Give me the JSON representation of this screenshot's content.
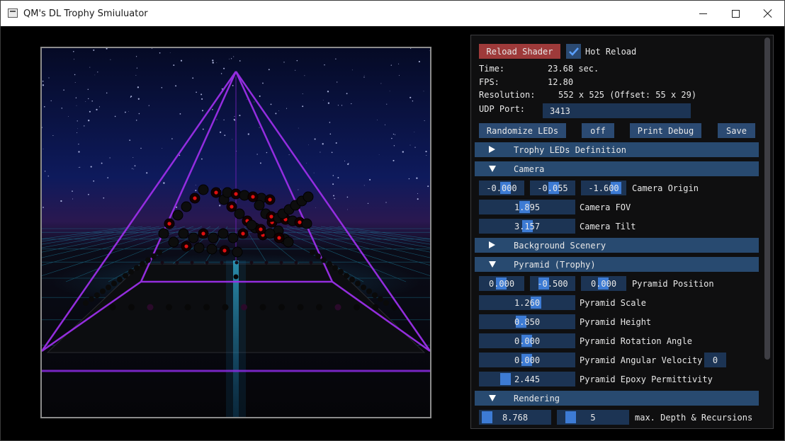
{
  "window": {
    "title": "QM's DL Trophy Smiuluator"
  },
  "panel": {
    "reload_shader": "Reload Shader",
    "hot_reload_label": "Hot Reload",
    "hot_reload_checked": true,
    "time_label": "Time:",
    "time_value": "23.68 sec.",
    "fps_label": "FPS:",
    "fps_value": "12.80",
    "resolution_label": "Resolution:",
    "resolution_value": "552 x 525 (Offset: 55 x 29)",
    "udp_label": "UDP Port:",
    "udp_value": "3413",
    "randomize_leds": "Randomize LEDs",
    "off": "off",
    "print_debug": "Print Debug",
    "save": "Save",
    "sections": {
      "trophy_leds": "Trophy LEDs Definition",
      "camera": "Camera",
      "background": "Background Scenery",
      "pyramid": "Pyramid (Trophy)",
      "rendering": "Rendering"
    },
    "camera": {
      "origin": [
        "-0.000",
        "-0.055",
        "-1.600"
      ],
      "origin_label": "Camera Origin",
      "fov": "1.895",
      "fov_label": "Camera FOV",
      "tilt": "3.157",
      "tilt_label": "Camera Tilt"
    },
    "pyramid": {
      "position": [
        "0.000",
        "-0.500",
        "0.000"
      ],
      "position_label": "Pyramid Position",
      "scale": "1.260",
      "scale_label": "Pyramid Scale",
      "height": "0.850",
      "height_label": "Pyramid Height",
      "rotation": "0.000",
      "rotation_label": "Pyramid Rotation Angle",
      "angular_velocity": "0.000",
      "angular_velocity_label": "Pyramid Angular Velocity",
      "angular_velocity_int": "0",
      "epoxy": "2.445",
      "epoxy_label": "Pyramid Epoxy Permittivity"
    },
    "rendering": {
      "value_a": "8.768",
      "value_b": "5",
      "label": "max. Depth & Recursions"
    }
  },
  "colors": {
    "accent": "#3d7bd4",
    "button": "#2b4a72",
    "header": "#284a70",
    "reload": "#9e3a3a"
  },
  "icons": {
    "collapsed": "triangle-right-icon",
    "expanded": "triangle-down-icon",
    "check": "check-icon"
  }
}
